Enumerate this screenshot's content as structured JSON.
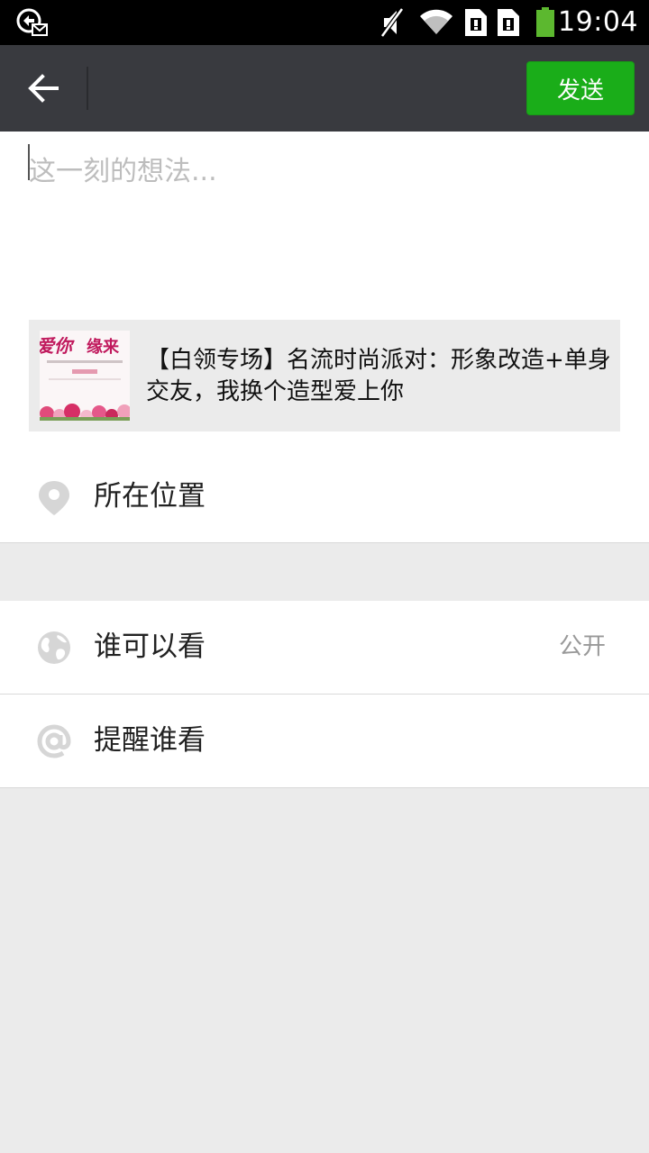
{
  "status_bar": {
    "time": "19:04",
    "icons": [
      "sync-mail-icon",
      "mute-icon",
      "wifi-icon",
      "sim-1-icon",
      "sim-2-icon",
      "battery-icon"
    ]
  },
  "title_bar": {
    "back_icon": "arrow-left-icon",
    "send_label": "发送",
    "send_color": "#1aad19",
    "background": "#393a3f"
  },
  "compose": {
    "placeholder": "这一刻的想法..."
  },
  "link_card": {
    "thumbnail_icon": "event-poster-thumbnail",
    "title": "【白领专场】名流时尚派对：形象改造+单身交友，我换个造型爱上你"
  },
  "options": {
    "location_label": "所在位置",
    "location_icon": "location-pin-icon",
    "visibility_label": "谁可以看",
    "visibility_value": "公开",
    "visibility_icon": "globe-icon",
    "remind_label": "提醒谁看",
    "remind_icon": "at-sign-icon"
  }
}
